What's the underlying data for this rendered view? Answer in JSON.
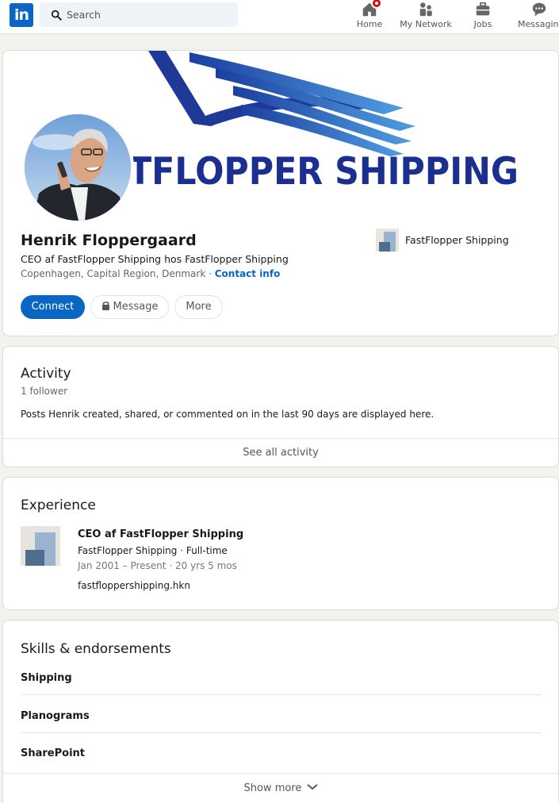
{
  "nav": {
    "logo": "in",
    "search_placeholder": "Search",
    "items": [
      {
        "label": "Home",
        "icon": "home-icon"
      },
      {
        "label": "My Network",
        "icon": "network-icon"
      },
      {
        "label": "Jobs",
        "icon": "briefcase-icon"
      },
      {
        "label": "Messaging",
        "icon": "message-icon"
      }
    ]
  },
  "profile": {
    "banner_text": "TFLOPPER SHIPPING",
    "name": "Henrik Floppergaard",
    "headline": "CEO af FastFlopper Shipping hos FastFlopper Shipping",
    "location": "Copenhagen, Capital Region, Denmark",
    "separator": " · ",
    "contact_info": "Contact info",
    "company": "FastFlopper Shipping",
    "buttons": {
      "connect": "Connect",
      "message": "Message",
      "more": "More"
    }
  },
  "activity": {
    "title": "Activity",
    "followers": "1 follower",
    "description": "Posts Henrik created, shared, or commented on in the last 90 days are displayed here.",
    "see_all": "See all activity"
  },
  "experience": {
    "title": "Experience",
    "items": [
      {
        "role": "CEO af FastFlopper Shipping",
        "company": "FastFlopper Shipping · Full-time",
        "dates": "Jan 2001 – Present · 20 yrs 5 mos",
        "url": "fastfloppershipping.hkn"
      }
    ]
  },
  "skills": {
    "title": "Skills & endorsements",
    "items": [
      "Shipping",
      "Planograms",
      "SharePoint"
    ],
    "show_more": "Show more"
  },
  "colors": {
    "brand": "#0a66c2",
    "banner_text": "#1a2f8f",
    "background": "#f3f2ef"
  }
}
